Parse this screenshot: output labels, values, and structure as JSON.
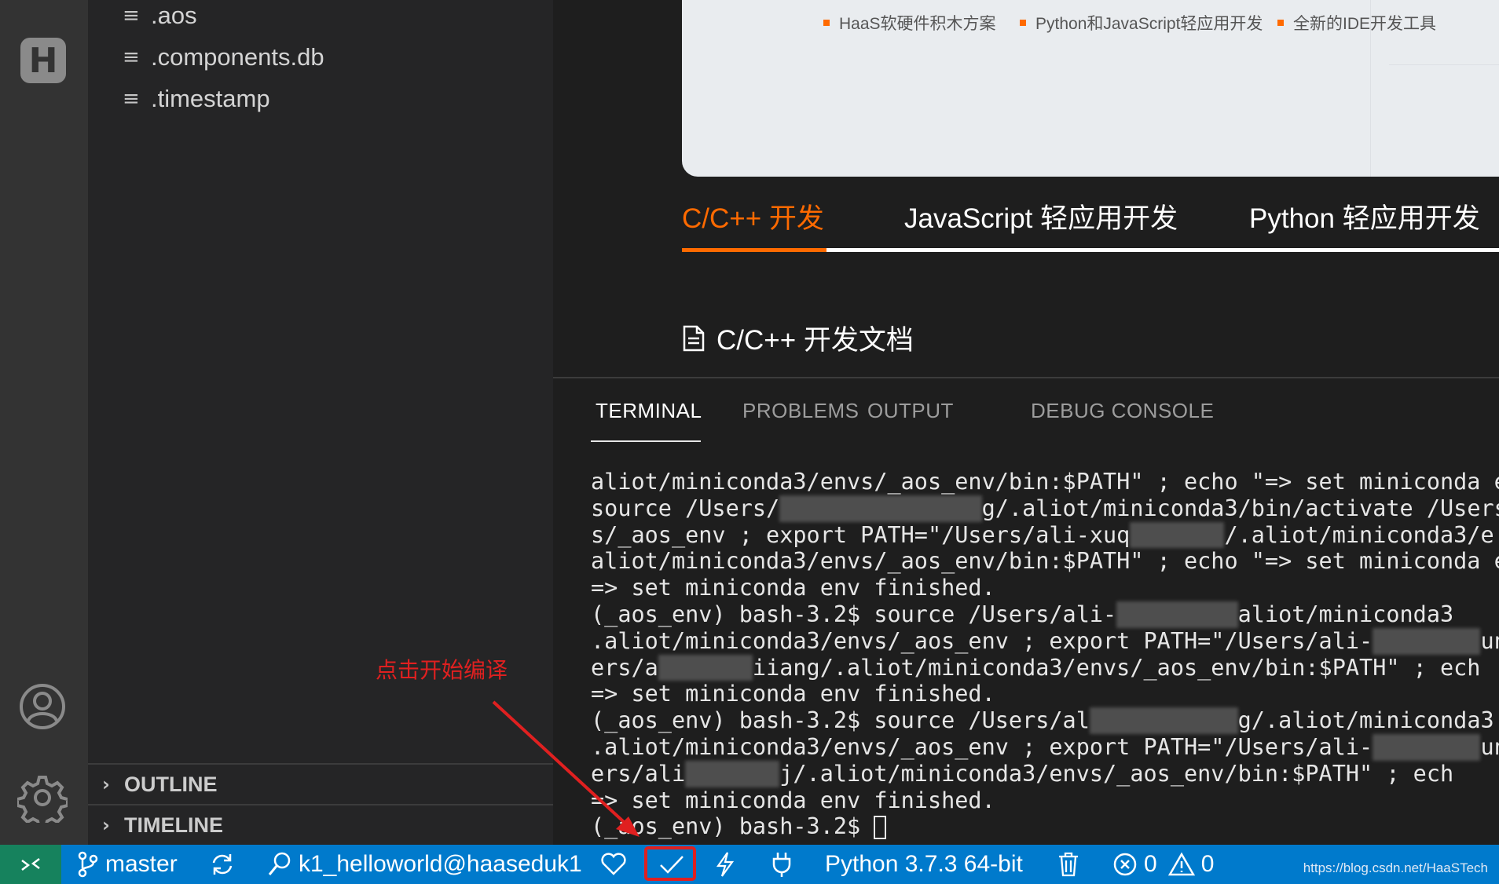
{
  "sidebar": {
    "files": [
      {
        "name": ".aos"
      },
      {
        "name": ".components.db"
      },
      {
        "name": ".timestamp"
      }
    ],
    "sections": [
      {
        "label": "OUTLINE"
      },
      {
        "label": "TIMELINE"
      }
    ]
  },
  "activity_bar": {
    "logo_text": "H",
    "icons": [
      "haas-logo-icon",
      "account-icon",
      "settings-gear-icon"
    ]
  },
  "banner": {
    "bullets": [
      "HaaS软硬件积木方案",
      "Python和JavaScript轻应用开发",
      "全新的IDE开发工具"
    ],
    "accent": "#ff6a00"
  },
  "doc_tabs": [
    {
      "label": "C/C++ 开发",
      "active": true
    },
    {
      "label": "JavaScript 轻应用开发",
      "active": false
    },
    {
      "label": "Python 轻应用开发",
      "active": false
    }
  ],
  "doc_title": "C/C++ 开发文档",
  "panel": {
    "tabs": [
      "TERMINAL",
      "PROBLEMS",
      "OUTPUT",
      "DEBUG CONSOLE"
    ],
    "active_tab": "TERMINAL"
  },
  "terminal": {
    "lines": [
      "aliot/miniconda3/envs/_aos_env/bin:$PATH\" ; echo \"=> set miniconda e",
      "source /Users/",
      "s/_aos_env ; export PATH=\"/Users/ali-xuq",
      "aliot/miniconda3/envs/_aos_env/bin:$PATH\" ; echo \"=> set miniconda e",
      "=> set miniconda env finished.",
      "(_aos_env) bash-3.2$ source /Users/ali-",
      ".aliot/miniconda3/envs/_aos_env ; export PATH=\"/Users/ali-",
      "ers/a",
      "=> set miniconda env finished.",
      "(_aos_env) bash-3.2$ source /Users/al",
      ".aliot/miniconda3/envs/_aos_env ; export PATH=\"/Users/ali-",
      "ers/ali",
      "=> set miniconda env finished.",
      "(_aos_env) bash-3.2$ "
    ],
    "line2_tail": "g/.aliot/miniconda3/bin/activate /Users/",
    "line3_tail": "/.aliot/miniconda3/e",
    "line6_tail": "aliot/miniconda3",
    "line7_tail": "un",
    "line8_tail": "iiang/.aliot/miniconda3/envs/_aos_env/bin:$PATH\" ; ech",
    "line10_tail": "g/.aliot/miniconda3",
    "line11_tail": "un",
    "line12_tail": "j/.aliot/miniconda3/envs/_aos_env/bin:$PATH\" ; ech"
  },
  "annotation": {
    "text": "点击开始编译",
    "color": "#e02020"
  },
  "statusbar": {
    "branch": "master",
    "project": "k1_helloworld@haaseduk1",
    "python": "Python 3.7.3 64-bit",
    "errors": "0",
    "warnings": "0",
    "watermark": "https://blog.csdn.net/HaaSTech",
    "color": "#007acc"
  }
}
